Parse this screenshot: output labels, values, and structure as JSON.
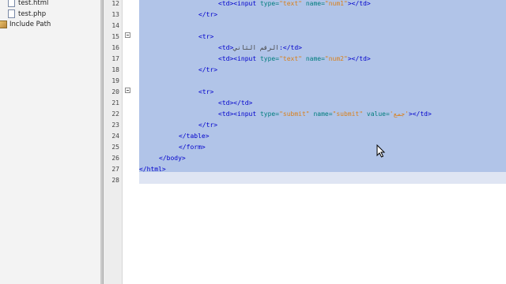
{
  "project_tree": {
    "items": [
      {
        "label": "test.html",
        "icon": "html-file-icon"
      },
      {
        "label": "test.php",
        "icon": "php-file-icon"
      },
      {
        "label": "Include Path",
        "icon": "library-icon"
      }
    ]
  },
  "editor": {
    "lines": [
      {
        "n": "12",
        "tokens": [
          [
            "t",
            "<td><input "
          ],
          [
            "a",
            "type="
          ],
          [
            "v",
            "\"text\""
          ],
          [
            "t",
            " "
          ],
          [
            "a",
            "name="
          ],
          [
            "v",
            "\"num1\""
          ],
          [
            "t",
            "></td>"
          ]
        ]
      },
      {
        "n": "13",
        "tokens": [
          [
            "t",
            "</tr>"
          ]
        ]
      },
      {
        "n": "14",
        "tokens": []
      },
      {
        "n": "15",
        "tokens": [
          [
            "t",
            "<tr>"
          ]
        ]
      },
      {
        "n": "16",
        "tokens": [
          [
            "t",
            "<td>"
          ],
          [
            "x",
            "الرقم الثاني"
          ],
          [
            "t",
            ":</td>"
          ]
        ]
      },
      {
        "n": "17",
        "tokens": [
          [
            "t",
            "<td><input "
          ],
          [
            "a",
            "type="
          ],
          [
            "v",
            "\"text\""
          ],
          [
            "t",
            " "
          ],
          [
            "a",
            "name="
          ],
          [
            "v",
            "\"num2\""
          ],
          [
            "t",
            "></td>"
          ]
        ]
      },
      {
        "n": "18",
        "tokens": [
          [
            "t",
            "</tr>"
          ]
        ]
      },
      {
        "n": "19",
        "tokens": []
      },
      {
        "n": "20",
        "tokens": [
          [
            "t",
            "<tr>"
          ]
        ]
      },
      {
        "n": "21",
        "tokens": [
          [
            "t",
            "<td></td>"
          ]
        ]
      },
      {
        "n": "22",
        "tokens": [
          [
            "t",
            "<td><input "
          ],
          [
            "a",
            "type="
          ],
          [
            "v",
            "\"submit\""
          ],
          [
            "t",
            " "
          ],
          [
            "a",
            "name="
          ],
          [
            "v",
            "\"submit\""
          ],
          [
            "t",
            " "
          ],
          [
            "a",
            "value="
          ],
          [
            "v",
            "'جمع'"
          ],
          [
            "t",
            "></td>"
          ]
        ]
      },
      {
        "n": "23",
        "tokens": [
          [
            "t",
            "</tr>"
          ]
        ]
      },
      {
        "n": "24",
        "tokens": [
          [
            "t",
            "</table>"
          ]
        ]
      },
      {
        "n": "25",
        "tokens": [
          [
            "t",
            "</form>"
          ]
        ]
      },
      {
        "n": "26",
        "tokens": [
          [
            "t",
            "</body>"
          ]
        ]
      },
      {
        "n": "27",
        "tokens": [
          [
            "t",
            "</html>"
          ]
        ]
      },
      {
        "n": "28",
        "tokens": []
      }
    ]
  },
  "colors": {
    "tag": "#0000cc",
    "attr": "#007d7d",
    "value": "#d9801c",
    "selection": "#b1c4e8"
  }
}
